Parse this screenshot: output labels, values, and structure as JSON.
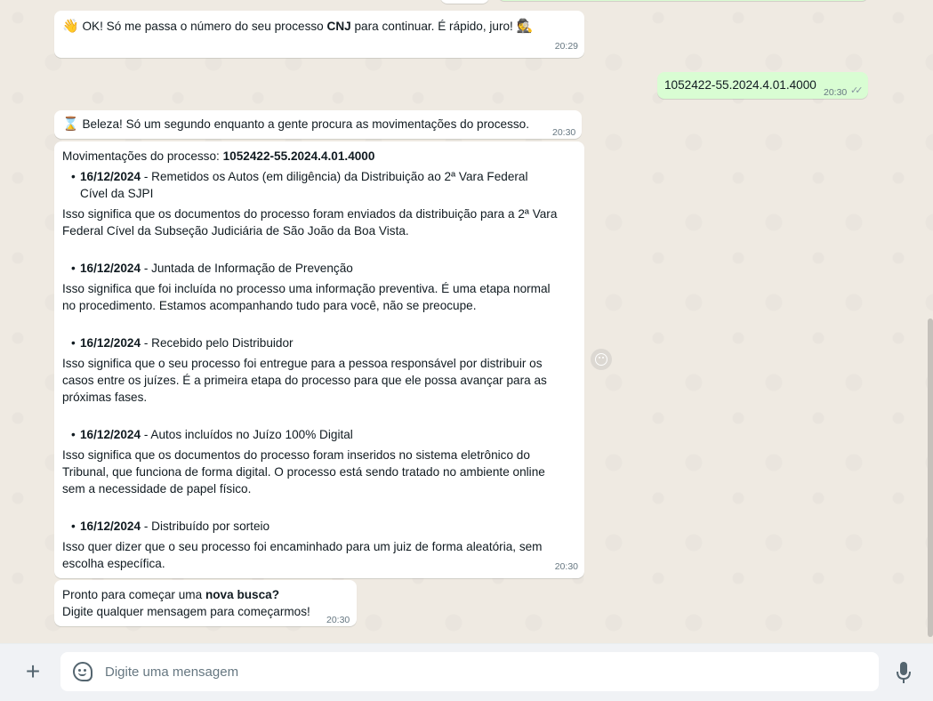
{
  "colors": {
    "chat_bg": "#efeae2",
    "incoming_bubble": "#ffffff",
    "outgoing_bubble": "#d9fdd3",
    "footer_bg": "#f0f2f5",
    "timestamp": "#667781",
    "icon": "#54656f"
  },
  "messages": {
    "m1": {
      "emoji_start": "👋",
      "text_before": " OK! Só me passa o número do seu processo ",
      "bold": "CNJ",
      "text_after": " para continuar. É rápido, juro! ",
      "emoji_end": "🕵",
      "time": "20:29"
    },
    "m2": {
      "text": "1052422-55.2024.4.01.4000",
      "time": "20:30",
      "ticks": "✓✓"
    },
    "m3": {
      "emoji": "⌛",
      "text": " Beleza! Só um segundo enquanto a gente procura as movimentações do processo.",
      "time": "20:30"
    },
    "m4": {
      "header_label": "Movimentações do processo: ",
      "header_number": "1052422-55.2024.4.01.4000",
      "items": [
        {
          "date": "16/12/2024",
          "title_line1": " - Remetidos os Autos (em diligência) da Distribuição ao 2ª Vara Federal",
          "title_line2": "Cível da SJPI",
          "explain": [
            "Isso significa que os documentos do processo foram enviados da distribuição para a 2ª Vara",
            "Federal Cível da Subseção Judiciária de São João da Boa Vista."
          ]
        },
        {
          "date": "16/12/2024",
          "title_line1": " - Juntada de Informação de Prevenção",
          "explain": [
            "Isso significa que foi incluída no processo uma informação preventiva. É uma etapa normal",
            "no procedimento. Estamos acompanhando tudo para você, não se preocupe."
          ]
        },
        {
          "date": "16/12/2024",
          "title_line1": " - Recebido pelo Distribuidor",
          "explain": [
            "Isso significa que o seu processo foi entregue para a pessoa responsável por distribuir os",
            "casos entre os juízes. É a primeira etapa do processo para que ele possa avançar para as",
            "próximas fases."
          ]
        },
        {
          "date": "16/12/2024",
          "title_line1": " - Autos incluídos no Juízo 100% Digital",
          "explain": [
            "Isso significa que os documentos do processo foram inseridos no sistema eletrônico do",
            "Tribunal, que funciona de forma digital. O processo está sendo tratado no ambiente online",
            "sem a necessidade de papel físico."
          ]
        },
        {
          "date": "16/12/2024",
          "title_line1": " - Distribuído por sorteio",
          "explain": [
            "Isso quer dizer que o seu processo foi encaminhado para um juiz de forma aleatória, sem",
            "escolha específica."
          ]
        }
      ],
      "time": "20:30"
    },
    "m5": {
      "line1_before": "Pronto para começar uma ",
      "line1_bold": "nova busca?",
      "line2": "Digite qualquer mensagem para começarmos!",
      "time": "20:30"
    }
  },
  "footer": {
    "plus_label": "+",
    "input_placeholder": "Digite uma mensagem",
    "input_value": "",
    "icons": [
      "plus-icon",
      "sticker-icon",
      "mic-icon"
    ]
  }
}
